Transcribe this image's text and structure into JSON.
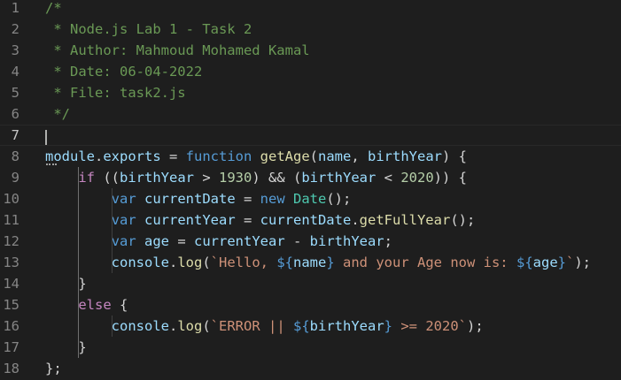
{
  "editor": {
    "language": "javascript",
    "current_line": 7,
    "colors": {
      "background": "#1e1e1e",
      "comment": "#6a9955",
      "keyword": "#569cd6",
      "control": "#c586c0",
      "variable": "#9cdcfe",
      "function": "#dcdcaa",
      "number": "#b5cea8",
      "string": "#ce9178",
      "class": "#4ec9b0",
      "text": "#d4d4d4",
      "line_number": "#858585"
    },
    "lines": [
      {
        "n": "1",
        "tokens": [
          {
            "t": "/*",
            "c": "comment"
          }
        ]
      },
      {
        "n": "2",
        "tokens": [
          {
            "t": " * Node.js Lab 1 - Task 2",
            "c": "comment"
          }
        ]
      },
      {
        "n": "3",
        "tokens": [
          {
            "t": " * Author: Mahmoud Mohamed Kamal",
            "c": "comment"
          }
        ]
      },
      {
        "n": "4",
        "tokens": [
          {
            "t": " * Date: 06-04-2022",
            "c": "comment"
          }
        ]
      },
      {
        "n": "5",
        "tokens": [
          {
            "t": " * File: task2.js",
            "c": "comment"
          }
        ]
      },
      {
        "n": "6",
        "tokens": [
          {
            "t": " */",
            "c": "comment"
          }
        ]
      },
      {
        "n": "7",
        "tokens": []
      },
      {
        "n": "8",
        "tokens": [
          {
            "t": "module",
            "c": "var"
          },
          {
            "t": ".",
            "c": "plain"
          },
          {
            "t": "exports",
            "c": "var"
          },
          {
            "t": " = ",
            "c": "plain"
          },
          {
            "t": "function",
            "c": "kw"
          },
          {
            "t": " ",
            "c": "plain"
          },
          {
            "t": "getAge",
            "c": "fn"
          },
          {
            "t": "(",
            "c": "plain"
          },
          {
            "t": "name",
            "c": "var"
          },
          {
            "t": ", ",
            "c": "plain"
          },
          {
            "t": "birthYear",
            "c": "var"
          },
          {
            "t": ") {",
            "c": "plain"
          }
        ]
      },
      {
        "n": "9",
        "tokens": [
          {
            "t": "    ",
            "c": "plain"
          },
          {
            "t": "if",
            "c": "ctl"
          },
          {
            "t": " ((",
            "c": "plain"
          },
          {
            "t": "birthYear",
            "c": "var"
          },
          {
            "t": " > ",
            "c": "plain"
          },
          {
            "t": "1930",
            "c": "num"
          },
          {
            "t": ") && (",
            "c": "plain"
          },
          {
            "t": "birthYear",
            "c": "var"
          },
          {
            "t": " < ",
            "c": "plain"
          },
          {
            "t": "2020",
            "c": "num"
          },
          {
            "t": ")) {",
            "c": "plain"
          }
        ]
      },
      {
        "n": "10",
        "tokens": [
          {
            "t": "        ",
            "c": "plain"
          },
          {
            "t": "var",
            "c": "kw"
          },
          {
            "t": " ",
            "c": "plain"
          },
          {
            "t": "currentDate",
            "c": "var"
          },
          {
            "t": " = ",
            "c": "plain"
          },
          {
            "t": "new",
            "c": "kw"
          },
          {
            "t": " ",
            "c": "plain"
          },
          {
            "t": "Date",
            "c": "cls"
          },
          {
            "t": "();",
            "c": "plain"
          }
        ]
      },
      {
        "n": "11",
        "tokens": [
          {
            "t": "        ",
            "c": "plain"
          },
          {
            "t": "var",
            "c": "kw"
          },
          {
            "t": " ",
            "c": "plain"
          },
          {
            "t": "currentYear",
            "c": "var"
          },
          {
            "t": " = ",
            "c": "plain"
          },
          {
            "t": "currentDate",
            "c": "var"
          },
          {
            "t": ".",
            "c": "plain"
          },
          {
            "t": "getFullYear",
            "c": "fn"
          },
          {
            "t": "();",
            "c": "plain"
          }
        ]
      },
      {
        "n": "12",
        "tokens": [
          {
            "t": "        ",
            "c": "plain"
          },
          {
            "t": "var",
            "c": "kw"
          },
          {
            "t": " ",
            "c": "plain"
          },
          {
            "t": "age",
            "c": "var"
          },
          {
            "t": " = ",
            "c": "plain"
          },
          {
            "t": "currentYear",
            "c": "var"
          },
          {
            "t": " - ",
            "c": "plain"
          },
          {
            "t": "birthYear",
            "c": "var"
          },
          {
            "t": ";",
            "c": "plain"
          }
        ]
      },
      {
        "n": "13",
        "tokens": [
          {
            "t": "        ",
            "c": "plain"
          },
          {
            "t": "console",
            "c": "var"
          },
          {
            "t": ".",
            "c": "plain"
          },
          {
            "t": "log",
            "c": "fn"
          },
          {
            "t": "(",
            "c": "plain"
          },
          {
            "t": "`Hello, ",
            "c": "str"
          },
          {
            "t": "${",
            "c": "kw"
          },
          {
            "t": "name",
            "c": "var"
          },
          {
            "t": "}",
            "c": "kw"
          },
          {
            "t": " and your Age now is: ",
            "c": "str"
          },
          {
            "t": "${",
            "c": "kw"
          },
          {
            "t": "age",
            "c": "var"
          },
          {
            "t": "}",
            "c": "kw"
          },
          {
            "t": "`",
            "c": "str"
          },
          {
            "t": ");",
            "c": "plain"
          }
        ]
      },
      {
        "n": "14",
        "tokens": [
          {
            "t": "    }",
            "c": "plain"
          }
        ]
      },
      {
        "n": "15",
        "tokens": [
          {
            "t": "    ",
            "c": "plain"
          },
          {
            "t": "else",
            "c": "ctl"
          },
          {
            "t": " {",
            "c": "plain"
          }
        ]
      },
      {
        "n": "16",
        "tokens": [
          {
            "t": "        ",
            "c": "plain"
          },
          {
            "t": "console",
            "c": "var"
          },
          {
            "t": ".",
            "c": "plain"
          },
          {
            "t": "log",
            "c": "fn"
          },
          {
            "t": "(",
            "c": "plain"
          },
          {
            "t": "`ERROR || ",
            "c": "str"
          },
          {
            "t": "${",
            "c": "kw"
          },
          {
            "t": "birthYear",
            "c": "var"
          },
          {
            "t": "}",
            "c": "kw"
          },
          {
            "t": " >= 2020",
            "c": "str"
          },
          {
            "t": "`",
            "c": "str"
          },
          {
            "t": ");",
            "c": "plain"
          }
        ]
      },
      {
        "n": "17",
        "tokens": [
          {
            "t": "    }",
            "c": "plain"
          }
        ]
      },
      {
        "n": "18",
        "tokens": [
          {
            "t": "};",
            "c": "plain"
          }
        ]
      }
    ]
  }
}
